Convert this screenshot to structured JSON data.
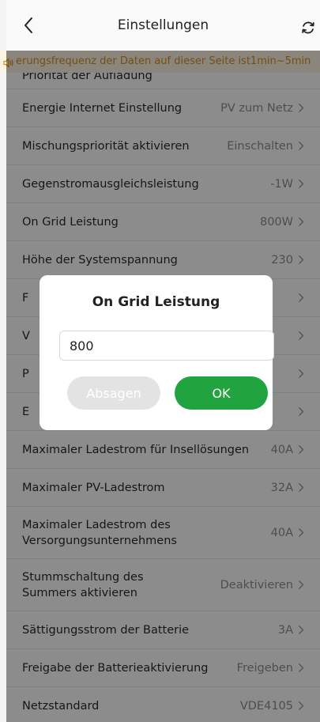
{
  "header": {
    "title": "Einstellungen"
  },
  "notice": {
    "text": "erungsfrequenz der Daten auf dieser Seite ist1min~5min"
  },
  "rows": [
    {
      "label": "Priorität der Aufladung",
      "value": ""
    },
    {
      "label": "Energie Internet Einstellung",
      "value": "PV zum Netz"
    },
    {
      "label": "Mischungspriorität aktivieren",
      "value": "Einschalten"
    },
    {
      "label": "Gegenstromausgleichsleistung",
      "value": "-1W"
    },
    {
      "label": "On Grid Leistung",
      "value": "800W"
    },
    {
      "label": "Höhe der Systemspannung",
      "value": "230"
    },
    {
      "label": "F",
      "value": ""
    },
    {
      "label": "V",
      "value": ""
    },
    {
      "label": "P",
      "value": ""
    },
    {
      "label": "E",
      "value": ""
    },
    {
      "label": "Maximaler Ladestrom für Insellösungen",
      "value": "40A"
    },
    {
      "label": "Maximaler PV-Ladestrom",
      "value": "32A"
    },
    {
      "label": "Maximaler Ladestrom des Versorgungsunternehmens",
      "value": "40A"
    },
    {
      "label": "Stummschaltung des Summers aktivieren",
      "value": "Deaktivieren"
    },
    {
      "label": "Sättigungsstrom der Batterie",
      "value": "3A"
    },
    {
      "label": "Freigabe der Batterieaktivierung",
      "value": "Freigeben"
    },
    {
      "label": "Netzstandard",
      "value": "VDE4105"
    }
  ],
  "dialog": {
    "title": "On Grid Leistung",
    "input_value": "800",
    "cancel_label": "Absagen",
    "ok_label": "OK"
  },
  "colors": {
    "accent": "#21a43f",
    "notice_text": "#d8901c",
    "notice_bg": "#fcf3e3"
  }
}
